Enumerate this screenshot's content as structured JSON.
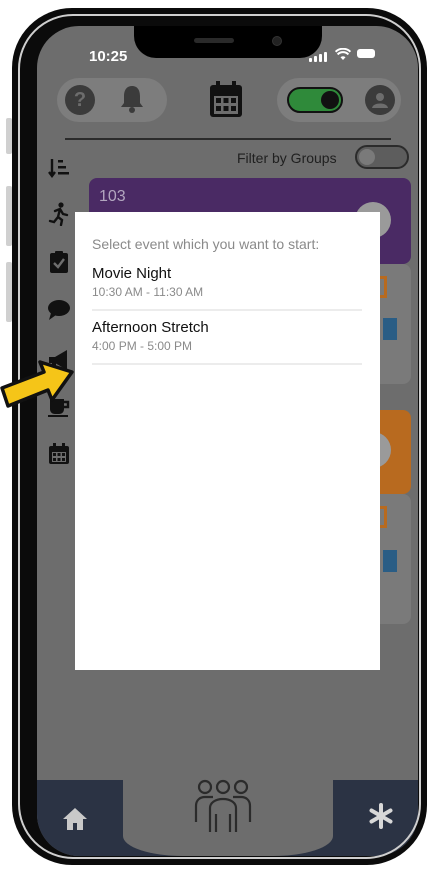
{
  "status_bar": {
    "time": "10:25"
  },
  "toolbar": {
    "help_icon": "question-circle-icon",
    "bell_icon": "bell-icon",
    "calendar_icon": "calendar-icon",
    "toggle_state": "on",
    "user_icon": "user-circle-icon"
  },
  "filter": {
    "label": "Filter by Groups"
  },
  "background_card": {
    "number": "103"
  },
  "modal": {
    "title": "Select event which you want to start:",
    "events": [
      {
        "name": "Movie Night",
        "time": "10:30 AM - 11:30 AM"
      },
      {
        "name": "Afternoon Stretch",
        "time": "4:00 PM - 5:00 PM"
      }
    ]
  },
  "bottom_nav": {
    "home_icon": "home-icon",
    "group_icon": "group-icon",
    "asterisk_icon": "asterisk-icon"
  },
  "colors": {
    "overlay_gray": "#6d6d6d",
    "purple_card": "#4a2a64",
    "orange_card": "#b86a1f",
    "toggle_green": "#2f8a3a",
    "nav_navy": "#2b3344",
    "arrow_yellow": "#f5c518"
  }
}
